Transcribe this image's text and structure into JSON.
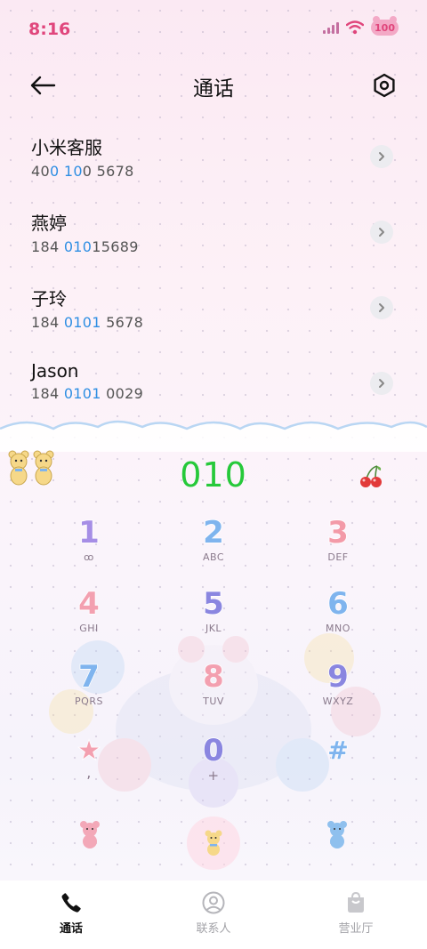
{
  "status_bar": {
    "time": "8:16",
    "battery": "100"
  },
  "header": {
    "title": "通话"
  },
  "contacts": [
    {
      "name": "小米客服",
      "number_parts": [
        "400 ",
        "10",
        "0 5678"
      ],
      "hl_index": 1,
      "number_pre": "40",
      "number_hl": "0 10",
      "number_post": "0 5678"
    },
    {
      "name": "燕婷",
      "number_pre": "184 ",
      "number_hl": "010",
      "number_post": "15689"
    },
    {
      "name": "子玲",
      "number_pre": "184 ",
      "number_hl": "0101",
      "number_post": " 5678"
    },
    {
      "name": "Jason",
      "number_pre": "184 ",
      "number_hl": "0101",
      "number_post": " 0029"
    }
  ],
  "dial": {
    "value": "010"
  },
  "keypad": [
    {
      "digit": "1",
      "letters": "ꝏ",
      "color": "#a68ee6"
    },
    {
      "digit": "2",
      "letters": "ABC",
      "color": "#7fb4ee"
    },
    {
      "digit": "3",
      "letters": "DEF",
      "color": "#f39aa8"
    },
    {
      "digit": "4",
      "letters": "GHI",
      "color": "#f3a0b0"
    },
    {
      "digit": "5",
      "letters": "JKL",
      "color": "#8a86e0"
    },
    {
      "digit": "6",
      "letters": "MNO",
      "color": "#7fb4ee"
    },
    {
      "digit": "7",
      "letters": "PQRS",
      "color": "#7fb4ee"
    },
    {
      "digit": "8",
      "letters": "TUV",
      "color": "#f3a0b0"
    },
    {
      "digit": "9",
      "letters": "WXYZ",
      "color": "#8a86e0"
    },
    {
      "digit": "★",
      "letters": ",",
      "color": "#f3a0b0"
    },
    {
      "digit": "0",
      "letters": "+",
      "color": "#8a86e0"
    },
    {
      "digit": "#",
      "letters": "",
      "color": "#7fb4ee"
    }
  ],
  "bottom_nav": {
    "calls": "通话",
    "contacts": "联系人",
    "store": "营业厅"
  },
  "colors": {
    "accent_green": "#26c93a",
    "highlight_blue": "#2f8fe3",
    "status_pink": "#e0467c"
  }
}
